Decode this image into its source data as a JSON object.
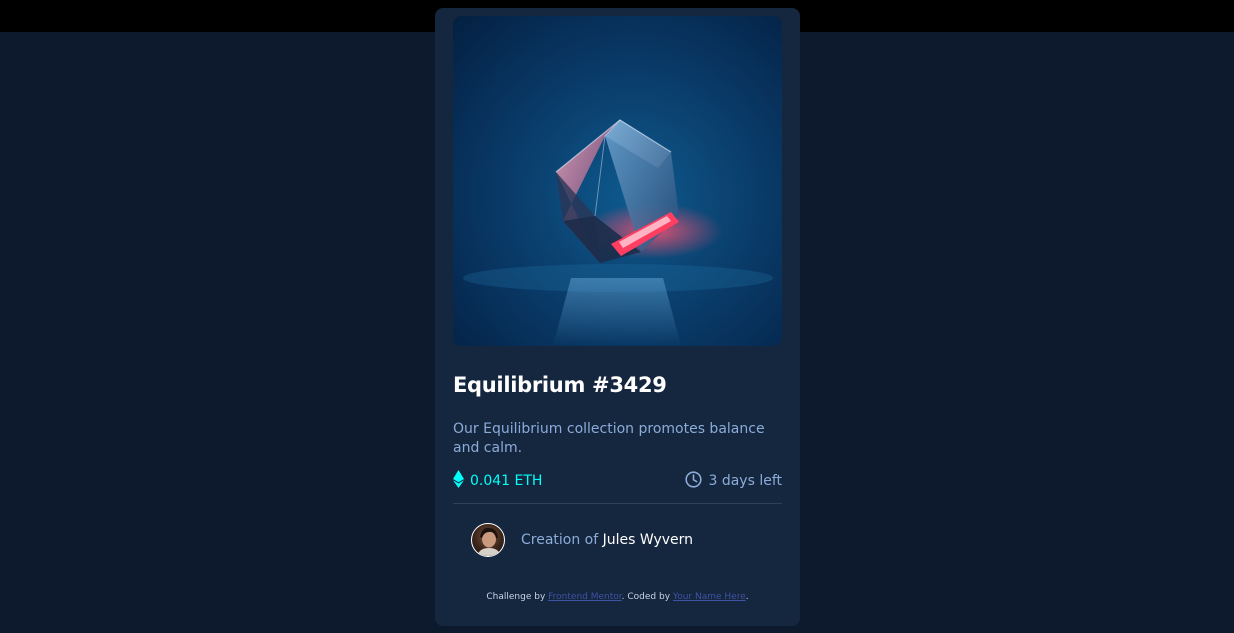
{
  "card": {
    "title": "Equilibrium #3429",
    "description": "Our Equilibrium collection promotes balance and calm.",
    "price": "0.041 ETH",
    "time_left": "3 days left",
    "creator_prefix": "Creation of",
    "creator_name": "Jules Wyvern"
  },
  "attribution": {
    "prefix": "Challenge by",
    "link1": "Frontend Mentor",
    "middle": ". Coded by",
    "link2": "Your Name Here",
    "suffix": "."
  },
  "icons": {
    "price": "ethereum-icon",
    "time": "clock-icon"
  },
  "colors": {
    "page_background": "#0d192c",
    "card_background": "#15263f",
    "accent_cyan": "#00fff8",
    "soft_blue": "#8bacd9",
    "white": "#ffffff",
    "link_blue": "#3e52a3"
  }
}
